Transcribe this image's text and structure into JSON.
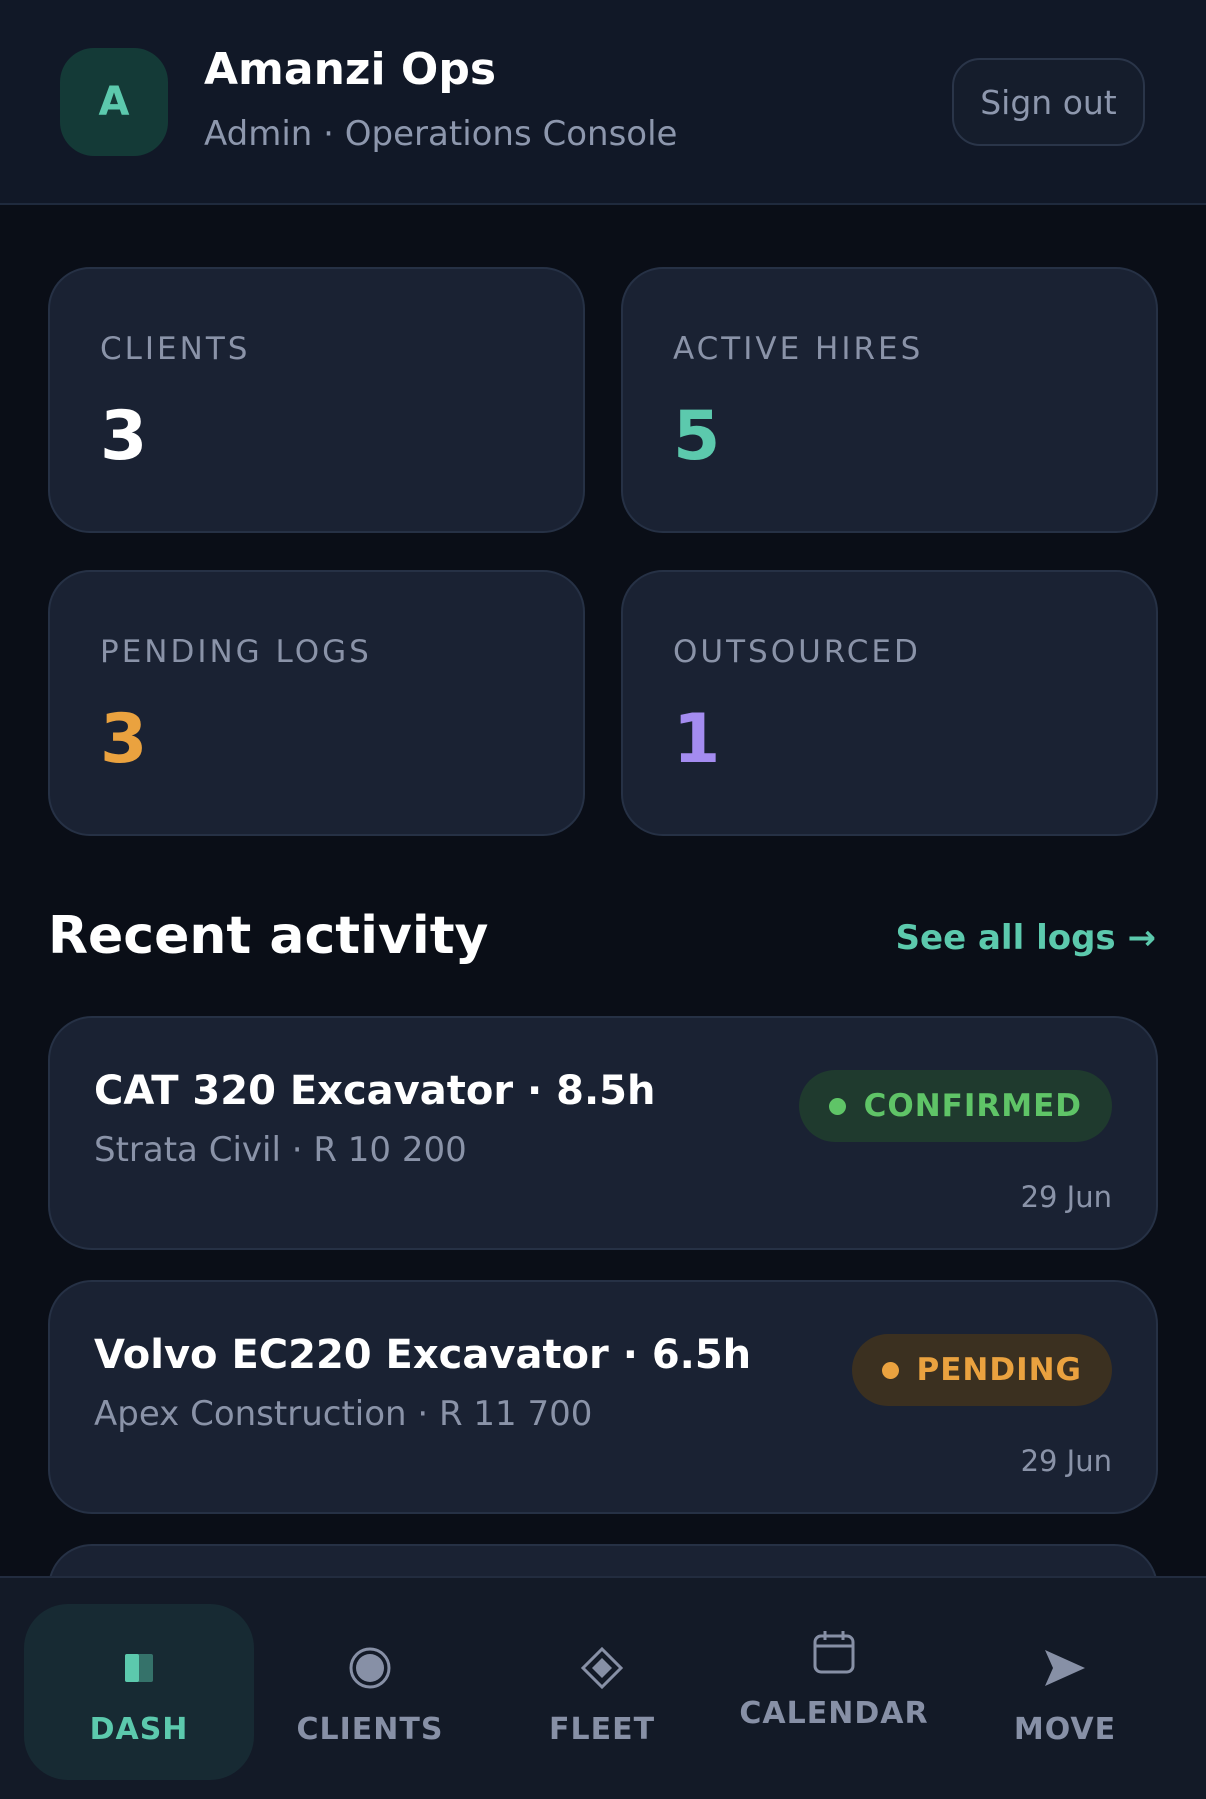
{
  "header": {
    "avatar_letter": "A",
    "title": "Amanzi Ops",
    "subtitle": "Admin · Operations Console",
    "signout_label": "Sign out"
  },
  "stats": [
    {
      "label": "CLIENTS",
      "value": "3",
      "color": "#ffffff"
    },
    {
      "label": "ACTIVE HIRES",
      "value": "5",
      "color": "#5cc9ad"
    },
    {
      "label": "PENDING LOGS",
      "value": "3",
      "color": "#eaa23f"
    },
    {
      "label": "OUTSOURCED",
      "value": "1",
      "color": "#a48cf0"
    }
  ],
  "recent": {
    "title": "Recent activity",
    "see_all_label": "See all logs →",
    "items": [
      {
        "title": "CAT 320 Excavator · 8.5h",
        "subtitle": "Strata Civil · R 10 200",
        "status": "CONFIRMED",
        "date": "29 Jun"
      },
      {
        "title": "Volvo EC220 Excavator · 6.5h",
        "subtitle": "Apex Construction · R 11 700",
        "status": "PENDING",
        "date": "29 Jun"
      }
    ]
  },
  "colors": {
    "accent": "#5cc9ad",
    "confirmed_text": "#5fc467",
    "confirmed_bg": "#1f3a2e",
    "pending_text": "#eaa23f",
    "pending_bg": "#3b3020"
  },
  "nav": {
    "active": "DASH",
    "items": [
      {
        "label": "DASH",
        "icon": "dashboard-icon"
      },
      {
        "label": "CLIENTS",
        "icon": "clients-icon"
      },
      {
        "label": "FLEET",
        "icon": "fleet-icon"
      },
      {
        "label": "CALENDAR",
        "icon": "calendar-icon"
      },
      {
        "label": "MOVE",
        "icon": "move-icon"
      }
    ]
  }
}
